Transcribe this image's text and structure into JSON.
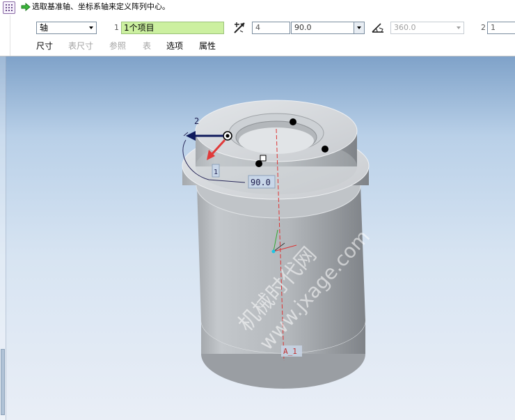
{
  "prompt": {
    "text": "选取基准轴、坐标系轴来定义阵列中心。"
  },
  "toolbar": {
    "pattern_type": "轴",
    "collector_index": "1",
    "collector_value": "1个项目",
    "first_dir_count": "4",
    "first_dir_angle": "90.0",
    "angle_extent": "360.0",
    "second_dir_index": "2",
    "second_dir_count": "1"
  },
  "tabs": [
    {
      "label": "尺寸",
      "enabled": true
    },
    {
      "label": "表尺寸",
      "enabled": false
    },
    {
      "label": "参照",
      "enabled": false
    },
    {
      "label": "表",
      "enabled": false
    },
    {
      "label": "选项",
      "enabled": true
    },
    {
      "label": "属性",
      "enabled": true
    }
  ],
  "model": {
    "dim_number": "2",
    "angle_dim": "90.0",
    "axis_label": "A_1",
    "small_dim": "1"
  },
  "watermark": {
    "line1": "机械时代网",
    "line2": "www.jxage.com"
  },
  "colors": {
    "collector_bg": "#ccf0a0",
    "axis": "#d33",
    "viewport_top": "#7fa2c9"
  }
}
